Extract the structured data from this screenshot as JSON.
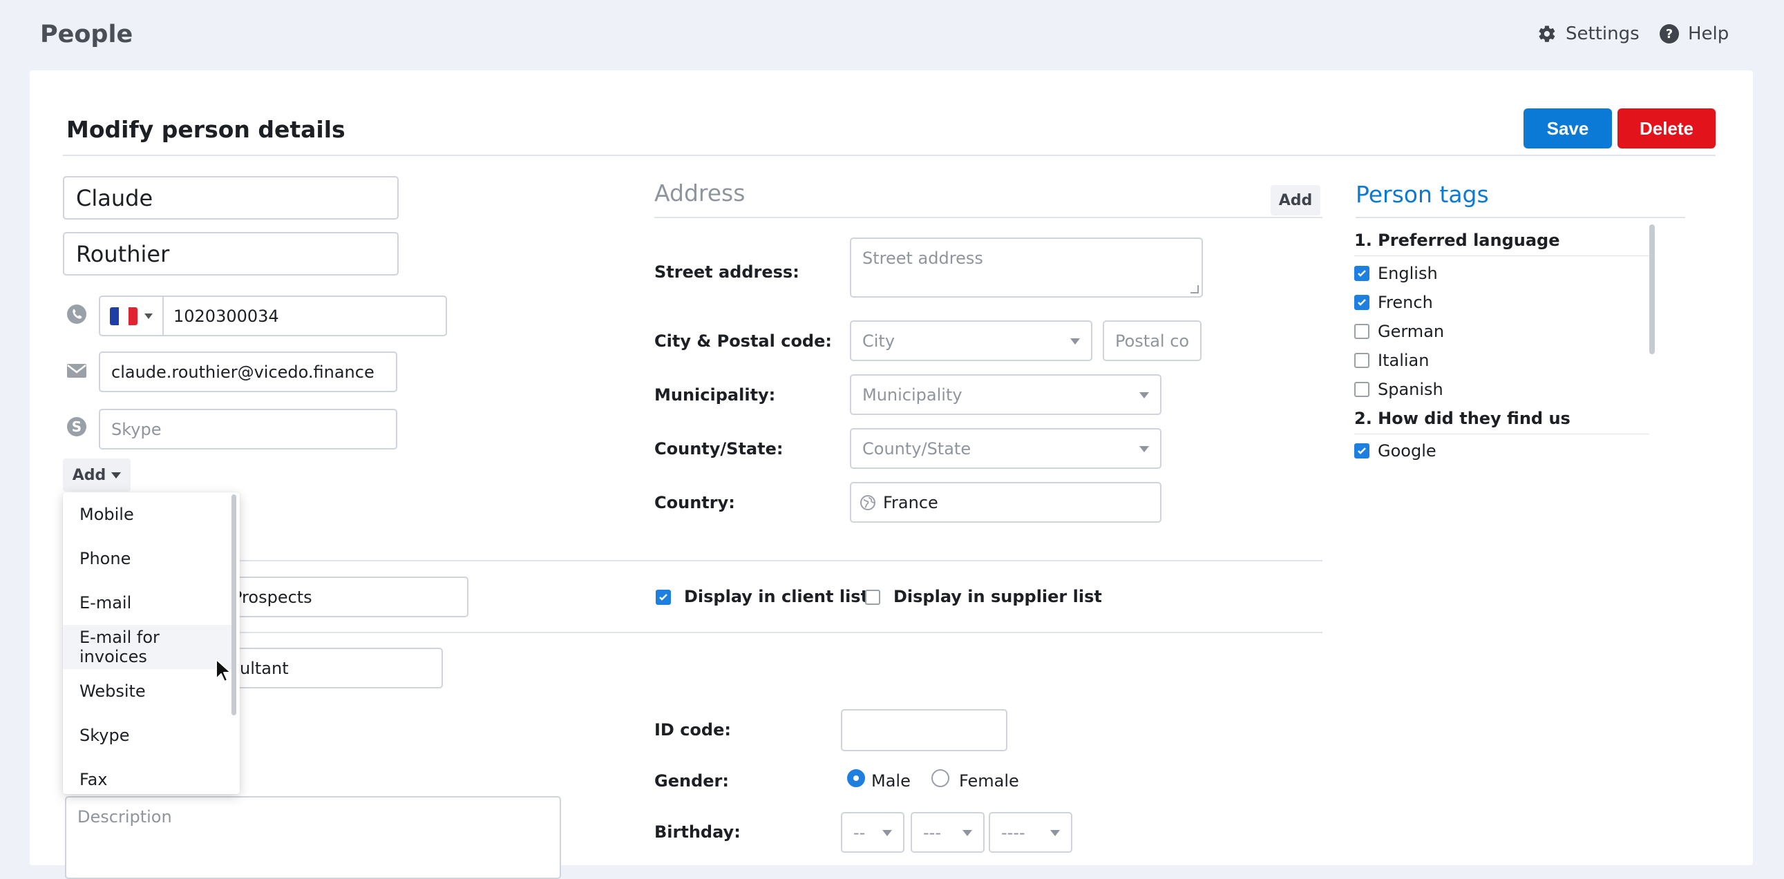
{
  "app": {
    "title": "People"
  },
  "topnav": {
    "settings": "Settings",
    "help": "Help"
  },
  "page": {
    "title": "Modify person details",
    "save_label": "Save",
    "delete_label": "Delete"
  },
  "person": {
    "first_name": "Claude",
    "last_name": "Routhier",
    "phone": "1020300034",
    "email": "claude.routhier@vicedo.finance",
    "skype_placeholder": "Skype",
    "add_label": "Add",
    "group_value": "Prospects",
    "role_value": "ultant",
    "description_placeholder": "Description"
  },
  "contact_add_menu": {
    "items": [
      "Mobile",
      "Phone",
      "E-mail",
      "E-mail for invoices",
      "Website",
      "Skype",
      "Fax"
    ],
    "hovered": "E-mail for invoices"
  },
  "address": {
    "title": "Address",
    "add_label": "Add",
    "street_label": "Street address:",
    "street_placeholder": "Street address",
    "city_label": "City & Postal code:",
    "city_placeholder": "City",
    "postal_placeholder": "Postal co",
    "municipality_label": "Municipality:",
    "municipality_placeholder": "Municipality",
    "county_label": "County/State:",
    "county_placeholder": "County/State",
    "country_label": "Country:",
    "country_value": "France"
  },
  "lists": {
    "client_label": "Display in client list",
    "client_checked": true,
    "supplier_label": "Display in supplier list",
    "supplier_checked": false
  },
  "details": {
    "id_label": "ID code:",
    "id_value": "",
    "gender_label": "Gender:",
    "male_label": "Male",
    "female_label": "Female",
    "gender_selected": "Male",
    "birthday_label": "Birthday:",
    "day_placeholder": "--",
    "month_placeholder": "---",
    "year_placeholder": "----"
  },
  "tags": {
    "title": "Person tags",
    "groups": [
      {
        "name": "1. Preferred language",
        "options": [
          {
            "label": "English",
            "checked": true
          },
          {
            "label": "French",
            "checked": true
          },
          {
            "label": "German",
            "checked": false
          },
          {
            "label": "Italian",
            "checked": false
          },
          {
            "label": "Spanish",
            "checked": false
          }
        ]
      },
      {
        "name": "2. How did they find us",
        "options": [
          {
            "label": "Google",
            "checked": true
          }
        ]
      }
    ]
  },
  "colors": {
    "primary": "#0a7ad6",
    "danger": "#e3131b",
    "checkbox": "#1d7fe0"
  }
}
